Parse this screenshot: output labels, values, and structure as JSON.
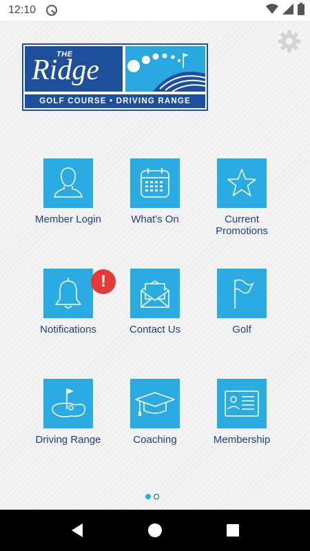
{
  "status_bar": {
    "time": "12:10",
    "icons": [
      "app-notification-icon",
      "wifi-icon",
      "signal-icon",
      "battery-icon"
    ]
  },
  "header": {
    "settings_icon": "gear-icon"
  },
  "logo": {
    "the": "THE",
    "name": "Ridge",
    "tagline": "GOLF COURSE • DRIVING RANGE"
  },
  "menu": {
    "items": [
      {
        "label": "Member Login",
        "icon": "person-icon"
      },
      {
        "label": "What's On",
        "icon": "calendar-icon"
      },
      {
        "label": "Current Promotions",
        "icon": "star-icon"
      },
      {
        "label": "Notifications",
        "icon": "bell-icon"
      },
      {
        "label": "Contact Us",
        "icon": "envelope-icon"
      },
      {
        "label": "Golf",
        "icon": "flag-icon"
      },
      {
        "label": "Driving Range",
        "icon": "golf-green-icon"
      },
      {
        "label": "Coaching",
        "icon": "graduation-cap-icon"
      },
      {
        "label": "Membership",
        "icon": "id-card-icon"
      }
    ],
    "notification_badge": "!"
  },
  "pager": {
    "current_page": 1,
    "total_pages": 2
  },
  "colors": {
    "tile": "#2aabe2",
    "label": "#1f3e85",
    "logo_dark_blue": "#1e4f9c",
    "logo_light_blue": "#29a8e0",
    "badge": "#e53935"
  }
}
